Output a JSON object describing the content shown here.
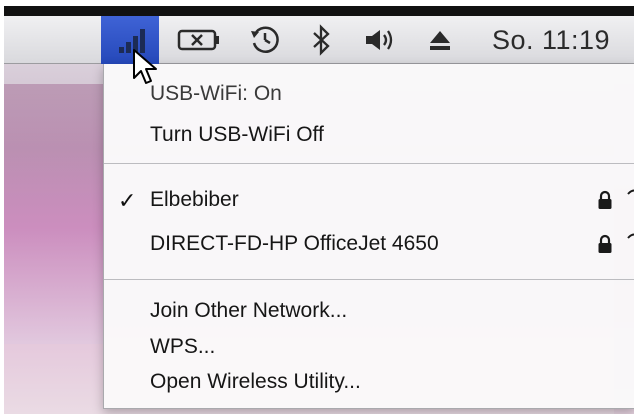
{
  "menubar": {
    "icons": [
      "wifi-signal-icon",
      "battery-icon",
      "time-machine-icon",
      "bluetooth-icon",
      "volume-icon",
      "eject-icon"
    ],
    "clock": "So. 11:19",
    "wifi_highlight_color": "#2f55c8"
  },
  "menu": {
    "status": "USB-WiFi: On",
    "toggle": "Turn USB-WiFi Off",
    "networks": [
      {
        "name": "Elbebiber",
        "selected": true,
        "locked": true
      },
      {
        "name": "DIRECT-FD-HP OfficeJet 4650",
        "selected": false,
        "locked": true
      }
    ],
    "actions": {
      "join_other": "Join Other Network...",
      "wps": "WPS...",
      "open_utility": "Open Wireless Utility..."
    }
  }
}
